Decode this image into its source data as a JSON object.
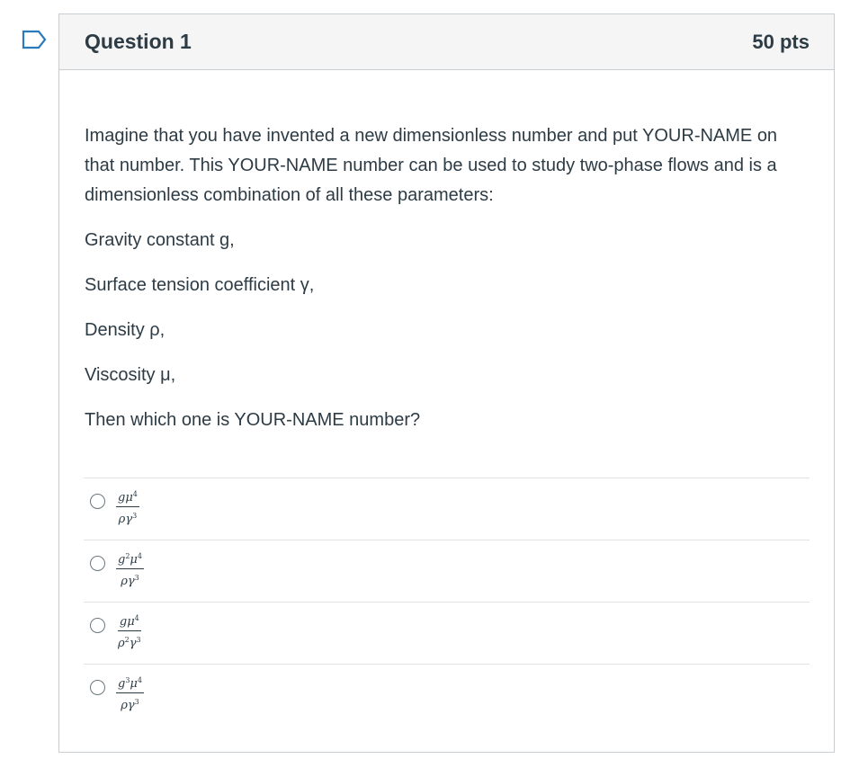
{
  "question": {
    "title": "Question 1",
    "points": "50 pts",
    "flag_icon": "flag-outline-icon",
    "accent_color": "#2b7abc",
    "body": {
      "intro": "Imagine that you have invented a new dimensionless number and put YOUR-NAME on that number. This YOUR-NAME number can be used to study two-phase flows and is a dimensionless combination of all these parameters:",
      "params": [
        "Gravity constant g,",
        "Surface tension coefficient γ,",
        "Density ρ,",
        "Viscosity μ,"
      ],
      "prompt": "Then which one is YOUR-NAME number?"
    },
    "answers": [
      {
        "num_base": "gμ",
        "num_g_exp": "",
        "num_mu_exp": "4",
        "den_rho_exp": "",
        "den_gamma_exp": "3",
        "selected": false
      },
      {
        "num_base": "g",
        "num_g_exp": "2",
        "num_mu_exp": "4",
        "den_rho_exp": "",
        "den_gamma_exp": "3",
        "selected": false
      },
      {
        "num_base": "gμ",
        "num_g_exp": "",
        "num_mu_exp": "4",
        "den_rho_exp": "2",
        "den_gamma_exp": "3",
        "selected": false
      },
      {
        "num_base": "g",
        "num_g_exp": "3",
        "num_mu_exp": "4",
        "den_rho_exp": "",
        "den_gamma_exp": "3",
        "selected": false
      }
    ]
  }
}
